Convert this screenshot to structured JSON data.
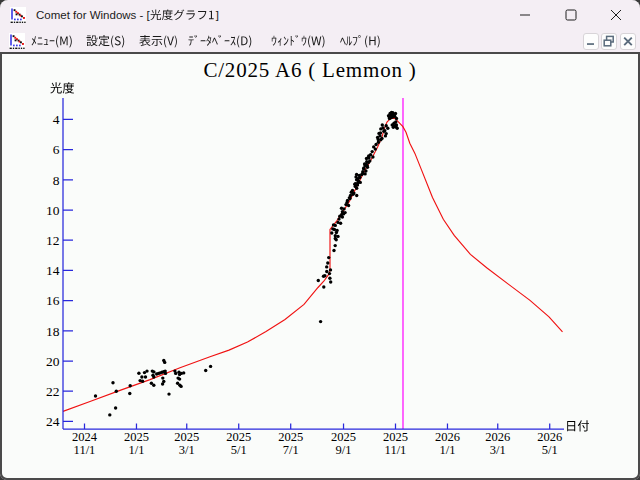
{
  "window": {
    "title": "Comet for Windows - [光度グラフ1]",
    "title_prefix": "Comet for Windows - [",
    "document_name": "光度グラフ1",
    "title_suffix": "]",
    "caption_buttons": [
      "minimize",
      "maximize",
      "close"
    ]
  },
  "menu_bar": {
    "items": [
      {
        "label": "ﾒﾆｭｰ(M)"
      },
      {
        "label": "設定(S)"
      },
      {
        "label": "表示(V)"
      },
      {
        "label": "ﾃﾞｰﾀﾍﾞｰｽ(D)"
      },
      {
        "label": "ｳｨﾝﾄﾞｳ(W)"
      },
      {
        "label": "ﾍﾙﾌﾟ(H)"
      }
    ],
    "mdi_buttons": [
      "minimize",
      "restore",
      "close"
    ]
  },
  "chart_data": {
    "type": "scatter",
    "title": "C/2025 A6 ( Lemmon )",
    "xlabel": "日付",
    "ylabel": "光度",
    "x_axis": {
      "epoch": "2024/11/1",
      "unit": "days since epoch",
      "ticks": [
        {
          "day": 0,
          "year": "2024",
          "date": "11/1"
        },
        {
          "day": 61,
          "year": "2025",
          "date": "1/1"
        },
        {
          "day": 120,
          "year": "2025",
          "date": "3/1"
        },
        {
          "day": 181,
          "year": "2025",
          "date": "5/1"
        },
        {
          "day": 242,
          "year": "2025",
          "date": "7/1"
        },
        {
          "day": 304,
          "year": "2025",
          "date": "9/1"
        },
        {
          "day": 365,
          "year": "2025",
          "date": "11/1"
        },
        {
          "day": 426,
          "year": "2026",
          "date": "1/1"
        },
        {
          "day": 485,
          "year": "2026",
          "date": "3/1"
        },
        {
          "day": 546,
          "year": "2026",
          "date": "5/1"
        }
      ]
    },
    "y_axis": {
      "label": "光度",
      "ticks": [
        4,
        6,
        8,
        10,
        12,
        14,
        16,
        18,
        20,
        22,
        24
      ],
      "inverted": true,
      "unit": "magnitude"
    },
    "event_line": {
      "day": 373.8,
      "approx_date": "2025/11/9",
      "color": "#ff00ff"
    },
    "series": [
      {
        "name": "model_light_curve",
        "type": "line",
        "color": "#f01212",
        "points": [
          [
            -25.2,
            23.34
          ],
          [
            6.5,
            22.68
          ],
          [
            41.7,
            21.95
          ],
          [
            76.9,
            21.23
          ],
          [
            112.1,
            20.45
          ],
          [
            147.3,
            19.72
          ],
          [
            169.6,
            19.28
          ],
          [
            191.3,
            18.74
          ],
          [
            213.0,
            18.05
          ],
          [
            235.3,
            17.25
          ],
          [
            257.6,
            16.25
          ],
          [
            274.0,
            15.13
          ],
          [
            281.1,
            14.7
          ],
          [
            286.4,
            14.28
          ],
          [
            288.1,
            14.04
          ],
          [
            288.1,
            11.29
          ],
          [
            296.3,
            10.7
          ],
          [
            304.6,
            10.0
          ],
          [
            311.0,
            9.41
          ],
          [
            319.3,
            8.47
          ],
          [
            324.5,
            7.88
          ],
          [
            329.8,
            7.3
          ],
          [
            336.0,
            6.71
          ],
          [
            341.3,
            6.13
          ],
          [
            344.0,
            5.82
          ],
          [
            346.8,
            5.46
          ],
          [
            349.5,
            5.09
          ],
          [
            351.4,
            4.74
          ],
          [
            353.1,
            4.42
          ],
          [
            355.0,
            4.17
          ],
          [
            357.7,
            4.01
          ],
          [
            360.5,
            3.93
          ],
          [
            363.2,
            3.93
          ],
          [
            365.1,
            3.97
          ],
          [
            367.8,
            4.13
          ],
          [
            370.6,
            4.29
          ],
          [
            373.7,
            4.48
          ],
          [
            377.3,
            4.85
          ],
          [
            381.8,
            5.58
          ],
          [
            387.8,
            6.25
          ],
          [
            395.8,
            7.38
          ],
          [
            408.4,
            9.17
          ],
          [
            421.1,
            10.61
          ],
          [
            433.9,
            11.68
          ],
          [
            452.9,
            12.94
          ],
          [
            472.0,
            13.83
          ],
          [
            497.4,
            14.91
          ],
          [
            522.9,
            15.99
          ],
          [
            545.2,
            17.07
          ],
          [
            561.0,
            18.07
          ]
        ]
      },
      {
        "name": "observations",
        "type": "scatter",
        "color": "#000000",
        "points": [
          [
            12.9,
            22.32
          ],
          [
            29.7,
            23.57
          ],
          [
            33.4,
            21.44
          ],
          [
            36.5,
            23.11
          ],
          [
            37.3,
            22.0
          ],
          [
            53.2,
            22.15
          ],
          [
            53.6,
            21.64
          ],
          [
            63.8,
            20.81
          ],
          [
            65.3,
            21.3
          ],
          [
            67.4,
            21.06
          ],
          [
            68.2,
            21.34
          ],
          [
            70.4,
            20.77
          ],
          [
            71.6,
            21.06
          ],
          [
            73.4,
            20.67
          ],
          [
            79.6,
            20.67
          ],
          [
            80.4,
            20.94
          ],
          [
            81.3,
            21.06
          ],
          [
            81.5,
            20.72
          ],
          [
            78.5,
            21.48
          ],
          [
            81.3,
            21.6
          ],
          [
            84.7,
            20.86
          ],
          [
            86.8,
            20.82
          ],
          [
            88.8,
            20.79
          ],
          [
            91.0,
            20.75
          ],
          [
            91.9,
            21.13
          ],
          [
            91.7,
            21.52
          ],
          [
            93.1,
            19.97
          ],
          [
            94.1,
            20.09
          ],
          [
            93.1,
            20.71
          ],
          [
            93.1,
            21.35
          ],
          [
            94.7,
            20.67
          ],
          [
            95.1,
            20.82
          ],
          [
            99.2,
            22.19
          ],
          [
            106.1,
            20.67
          ],
          [
            107.0,
            20.82
          ],
          [
            109.3,
            21.48
          ],
          [
            109.9,
            21.13
          ],
          [
            110.9,
            20.75
          ],
          [
            111.6,
            20.9
          ],
          [
            111.6,
            21.2
          ],
          [
            112.0,
            21.6
          ],
          [
            113.4,
            21.68
          ],
          [
            113.6,
            20.82
          ],
          [
            116.4,
            20.79
          ],
          [
            142.2,
            20.63
          ],
          [
            148.0,
            20.36
          ],
          [
            277.1,
            17.39
          ],
          [
            274.4,
            14.67
          ],
          [
            280.5,
            14.39
          ],
          [
            280.9,
            15.1
          ],
          [
            282.1,
            14.36
          ],
          [
            284.3,
            13.77
          ],
          [
            284.4,
            14.07
          ],
          [
            286.6,
            13.15
          ],
          [
            288.0,
            14.52
          ],
          [
            288.7,
            13.97
          ],
          [
            289.0,
            14.77
          ],
          [
            290.2,
            11.52
          ],
          [
            291.4,
            11.25
          ],
          [
            292.2,
            10.99
          ],
          [
            293.3,
            11.29
          ],
          [
            292.8,
            12.68
          ],
          [
            294.3,
            11.02
          ],
          [
            294.3,
            11.7
          ],
          [
            294.3,
            11.89
          ],
          [
            294.2,
            12.36
          ],
          [
            295.4,
            11.97
          ],
          [
            295.6,
            11.49
          ],
          [
            296.5,
            11.35
          ],
          [
            297.5,
            10.82
          ],
          [
            297.5,
            11.75
          ],
          [
            299.6,
            10.41
          ],
          [
            300.6,
            10.88
          ],
          [
            301.6,
            9.88
          ],
          [
            302.7,
            10.11
          ],
          [
            302.7,
            10.47
          ],
          [
            304.0,
            10.26
          ],
          [
            304.6,
            9.93
          ],
          [
            305.9,
            10.17
          ],
          [
            306.9,
            9.64
          ],
          [
            308.7,
            9.37
          ],
          [
            310.0,
            9.7
          ],
          [
            311.0,
            9.18
          ],
          [
            312.2,
            9.04
          ],
          [
            313.1,
            8.82
          ],
          [
            316.2,
            8.88
          ],
          [
            315.2,
            8.96
          ],
          [
            317.2,
            8.3
          ],
          [
            318.1,
            8.25
          ],
          [
            318.6,
            7.81
          ],
          [
            319.3,
            7.65
          ],
          [
            319.3,
            8.0
          ],
          [
            319.5,
            8.56
          ],
          [
            319.5,
            9.04
          ],
          [
            320.4,
            8.35
          ],
          [
            320.9,
            7.93
          ],
          [
            321.6,
            8.08
          ],
          [
            322.5,
            7.71
          ],
          [
            323.7,
            8.17
          ],
          [
            326.6,
            7.47
          ],
          [
            326.6,
            7.58
          ],
          [
            327.6,
            7.27
          ],
          [
            327.9,
            7.21
          ],
          [
            328.7,
            6.95
          ],
          [
            329.3,
            7.06
          ],
          [
            329.3,
            7.61
          ],
          [
            330.3,
            7.42
          ],
          [
            330.7,
            6.98
          ],
          [
            331.0,
            6.59
          ],
          [
            331.2,
            6.8
          ],
          [
            331.8,
            7.06
          ],
          [
            332.1,
            7.17
          ],
          [
            333.1,
            6.54
          ],
          [
            333.3,
            6.85
          ],
          [
            333.5,
            6.42
          ],
          [
            333.9,
            6.54
          ],
          [
            334.8,
            6.75
          ],
          [
            335.8,
            6.34
          ],
          [
            337.7,
            6.13
          ],
          [
            338.5,
            6.49
          ],
          [
            339.4,
            5.82
          ],
          [
            341.3,
            5.97
          ],
          [
            342.2,
            5.66
          ],
          [
            344.0,
            5.2
          ],
          [
            344.9,
            5.51
          ],
          [
            345.6,
            4.93
          ],
          [
            346.8,
            5.09
          ],
          [
            347.7,
            4.63
          ],
          [
            347.7,
            5.35
          ],
          [
            349.2,
            5.26
          ],
          [
            349.5,
            4.37
          ],
          [
            351.4,
            4.79
          ],
          [
            353.1,
            5.09
          ],
          [
            354.1,
            4.42
          ],
          [
            354.1,
            4.94
          ],
          [
            356.0,
            4.58
          ],
          [
            356.9,
            3.75
          ],
          [
            358.0,
            3.94
          ],
          [
            358.7,
            3.6
          ],
          [
            360.3,
            3.54
          ],
          [
            361.1,
            4.37
          ],
          [
            361.5,
            3.84
          ],
          [
            362.4,
            3.7
          ],
          [
            362.4,
            4.52
          ],
          [
            363.2,
            4.26
          ],
          [
            364.2,
            3.8
          ],
          [
            364.6,
            4.47
          ],
          [
            365.0,
            3.61
          ],
          [
            366.1,
            4.37
          ],
          [
            366.2,
            3.94
          ],
          [
            367.0,
            4.58
          ],
          [
            298.7,
            10.6
          ],
          [
            302.0,
            10.3
          ],
          [
            308.1,
            9.5
          ],
          [
            311.6,
            9.24
          ],
          [
            314.5,
            8.71
          ],
          [
            317.7,
            8.44
          ],
          [
            320.8,
            8.21
          ],
          [
            323.1,
            7.85
          ],
          [
            325.5,
            7.65
          ],
          [
            357.4,
            3.81
          ],
          [
            359.7,
            3.71
          ],
          [
            361.8,
            3.56
          ],
          [
            363.8,
            3.68
          ],
          [
            359.5,
            3.89
          ],
          [
            363.0,
            4.42
          ],
          [
            365.6,
            4.49
          ],
          [
            365.4,
            4.17
          ],
          [
            347.4,
            4.9
          ],
          [
            344.7,
            5.33
          ],
          [
            350.3,
            4.57
          ],
          [
            352.4,
            4.75
          ],
          [
            285.5,
            13.51
          ],
          [
            287.5,
            14.21
          ]
        ]
      }
    ]
  },
  "colors": {
    "axis": "#2828dc",
    "curve": "#f01212",
    "event_line": "#ff00ff",
    "points": "#000000",
    "titlebar_bg": "#f4eef4",
    "client_bg": "#fafcfa",
    "frame": "#4a4a4a",
    "mdi_glyph": "#5a6b7c",
    "text": "#1a1a1a"
  }
}
